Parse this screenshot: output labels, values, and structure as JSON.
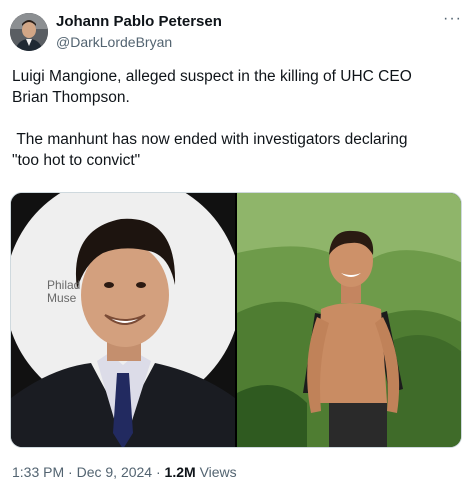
{
  "tweet": {
    "author_name": "Johann Pablo Petersen",
    "author_handle": "@DarkLordeBryan",
    "more_icon": "···",
    "text": "Luigi Mangione, alleged suspect in the killing of UHC CEO\nBrian Thompson.\n\n The manhunt has now ended with investigators declaring\n\"too hot to convict\"",
    "media_watermark_line1": "Philad",
    "media_watermark_line2": "Muse",
    "time": "1:33 PM",
    "separator": "·",
    "date": "Dec 9, 2024",
    "views_count": "1.2M",
    "views_label": "Views"
  },
  "colors": {
    "text_primary": "#0f1419",
    "text_secondary": "#536471",
    "border": "#cfd9de"
  }
}
